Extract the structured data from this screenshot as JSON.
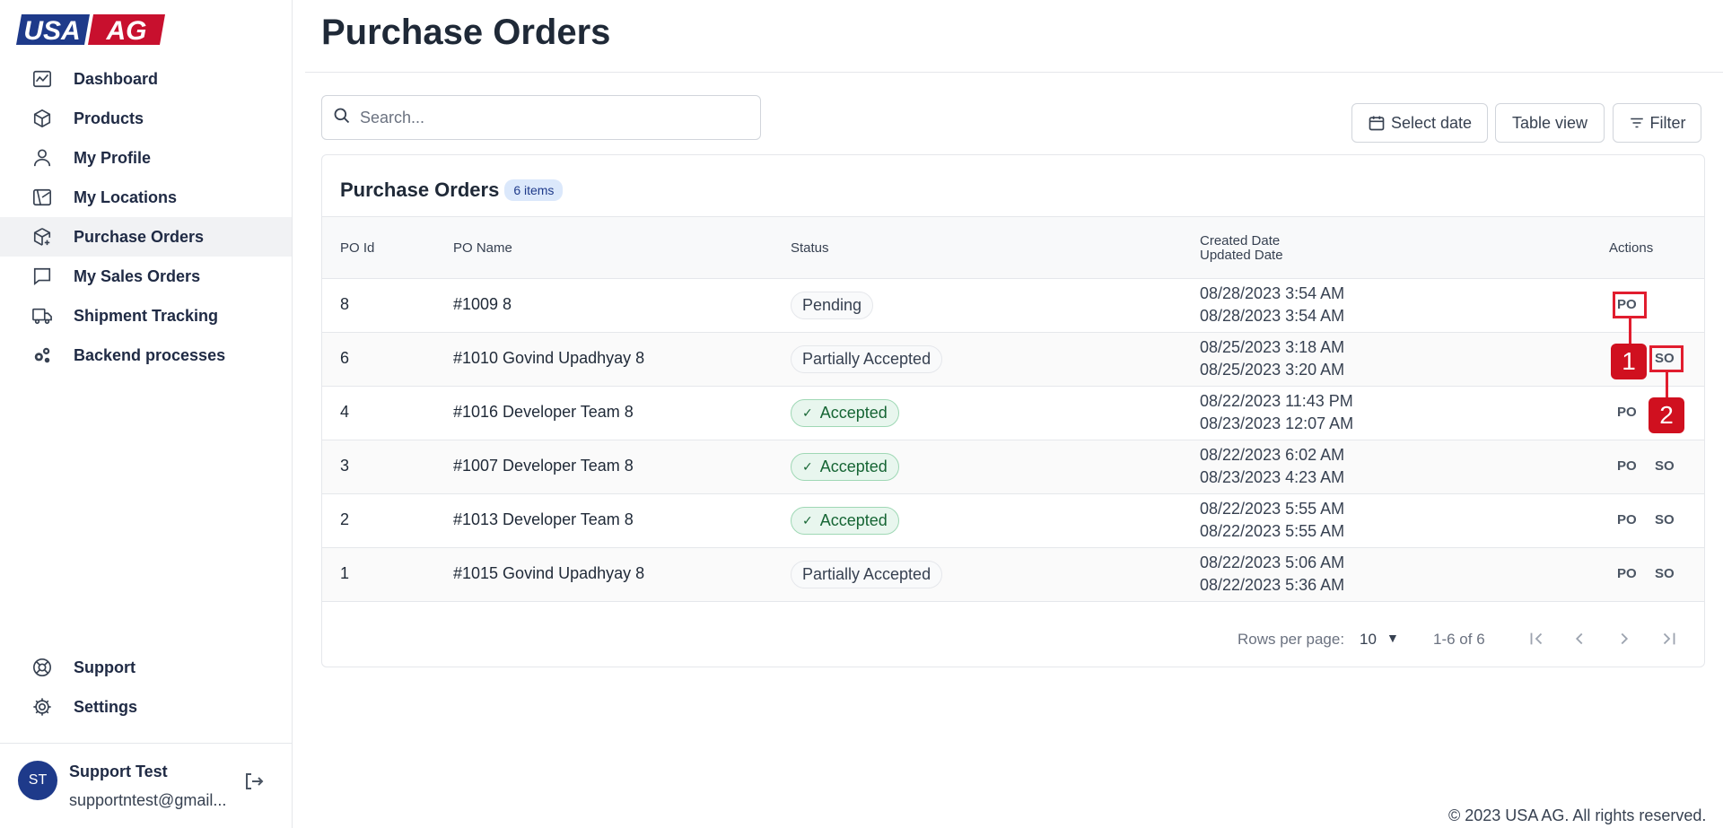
{
  "brand": {
    "logo_text_1": "USA",
    "logo_text_2": "AG",
    "primary": "#1e3a8a",
    "accent": "#c8102e"
  },
  "sidebar": {
    "items": [
      {
        "label": "Dashboard",
        "icon": "chart-icon"
      },
      {
        "label": "Products",
        "icon": "box-icon"
      },
      {
        "label": "My Profile",
        "icon": "user-icon"
      },
      {
        "label": "My Locations",
        "icon": "map-icon"
      },
      {
        "label": "Purchase Orders",
        "icon": "box-add-icon",
        "active": true
      },
      {
        "label": "My Sales Orders",
        "icon": "chat-icon"
      },
      {
        "label": "Shipment Tracking",
        "icon": "truck-icon"
      },
      {
        "label": "Backend processes",
        "icon": "gears-icon"
      }
    ],
    "bottom_items": [
      {
        "label": "Support",
        "icon": "lifebuoy-icon"
      },
      {
        "label": "Settings",
        "icon": "gear-icon"
      }
    ],
    "user": {
      "initials": "ST",
      "name": "Support Test",
      "email": "supportntest@gmail..."
    }
  },
  "page": {
    "title": "Purchase Orders",
    "search_placeholder": "Search...",
    "buttons": {
      "select_date": "Select date",
      "table_view": "Table view",
      "filter": "Filter"
    }
  },
  "card": {
    "title": "Purchase Orders",
    "badge": "6 items",
    "columns": {
      "po_id": "PO Id",
      "po_name": "PO Name",
      "status": "Status",
      "created": "Created Date",
      "updated": "Updated Date",
      "actions": "Actions"
    },
    "rows": [
      {
        "id": "8",
        "name": "#1009 8",
        "status": "Pending",
        "accepted": false,
        "created": "08/28/2023 3:54 AM",
        "updated": "08/28/2023 3:54 AM",
        "po": "PO",
        "so": ""
      },
      {
        "id": "6",
        "name": "#1010 Govind Upadhyay 8",
        "status": "Partially Accepted",
        "accepted": false,
        "created": "08/25/2023 3:18 AM",
        "updated": "08/25/2023 3:20 AM",
        "po": "",
        "so": "SO"
      },
      {
        "id": "4",
        "name": "#1016 Developer Team 8",
        "status": "Accepted",
        "accepted": true,
        "created": "08/22/2023 11:43 PM",
        "updated": "08/23/2023 12:07 AM",
        "po": "PO",
        "so": ""
      },
      {
        "id": "3",
        "name": "#1007 Developer Team 8",
        "status": "Accepted",
        "accepted": true,
        "created": "08/22/2023 6:02 AM",
        "updated": "08/23/2023 4:23 AM",
        "po": "PO",
        "so": "SO"
      },
      {
        "id": "2",
        "name": "#1013 Developer Team 8",
        "status": "Accepted",
        "accepted": true,
        "created": "08/22/2023 5:55 AM",
        "updated": "08/22/2023 5:55 AM",
        "po": "PO",
        "so": "SO"
      },
      {
        "id": "1",
        "name": "#1015 Govind Upadhyay 8",
        "status": "Partially Accepted",
        "accepted": false,
        "created": "08/22/2023 5:06 AM",
        "updated": "08/22/2023 5:36 AM",
        "po": "PO",
        "so": "SO"
      }
    ],
    "pagination": {
      "rows_per_page_label": "Rows per page:",
      "rows_per_page": "10",
      "range": "1-6 of 6"
    }
  },
  "annotations": {
    "marker_1": "1",
    "marker_2": "2"
  },
  "footer": "© 2023 USA AG. All rights reserved."
}
